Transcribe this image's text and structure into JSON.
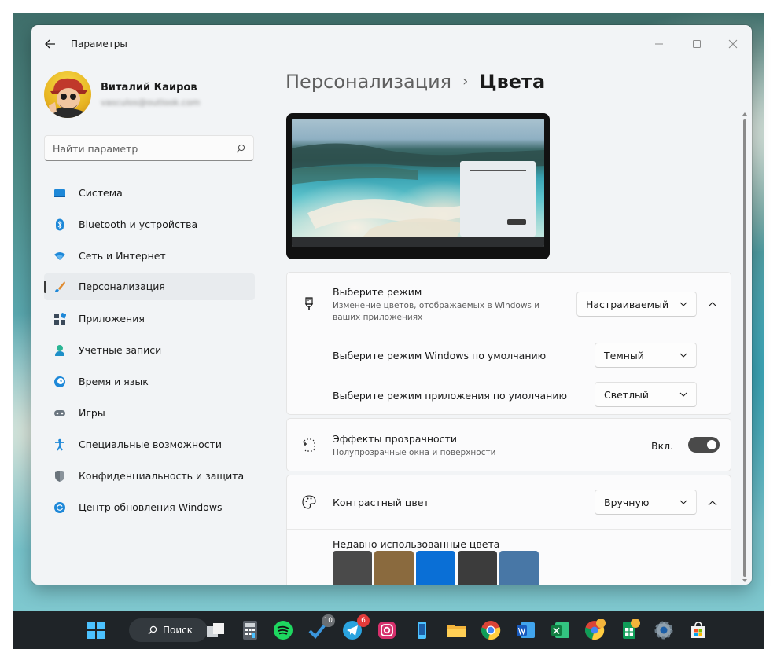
{
  "window": {
    "title": "Параметры"
  },
  "profile": {
    "name": "Виталий Каиров",
    "email": "vasculos@outlook.com"
  },
  "search": {
    "placeholder": "Найти параметр"
  },
  "sidebar": {
    "items": [
      {
        "label": "Система",
        "icon": "system-icon",
        "selected": false
      },
      {
        "label": "Bluetooth и устройства",
        "icon": "bluetooth-icon",
        "selected": false
      },
      {
        "label": "Сеть и Интернет",
        "icon": "wifi-icon",
        "selected": false
      },
      {
        "label": "Персонализация",
        "icon": "brush-icon",
        "selected": true
      },
      {
        "label": "Приложения",
        "icon": "apps-icon",
        "selected": false
      },
      {
        "label": "Учетные записи",
        "icon": "user-icon",
        "selected": false
      },
      {
        "label": "Время и язык",
        "icon": "clock-globe-icon",
        "selected": false
      },
      {
        "label": "Игры",
        "icon": "gamepad-icon",
        "selected": false
      },
      {
        "label": "Специальные возможности",
        "icon": "accessibility-icon",
        "selected": false
      },
      {
        "label": "Конфиденциальность и защита",
        "icon": "shield-icon",
        "selected": false
      },
      {
        "label": "Центр обновления Windows",
        "icon": "update-icon",
        "selected": false
      }
    ]
  },
  "breadcrumb": {
    "parent": "Персонализация",
    "separator": "›",
    "current": "Цвета"
  },
  "mode_card": {
    "title": "Выберите режим",
    "subtitle": "Изменение цветов, отображаемых в Windows и ваших приложениях",
    "value": "Настраиваемый",
    "expanded": true,
    "windows_mode": {
      "label": "Выберите режим Windows по умолчанию",
      "value": "Темный"
    },
    "app_mode": {
      "label": "Выберите режим приложения по умолчанию",
      "value": "Светлый"
    }
  },
  "transparency_card": {
    "title": "Эффекты прозрачности",
    "subtitle": "Полупрозрачные окна и поверхности",
    "state_label": "Вкл.",
    "on": true
  },
  "accent_card": {
    "title": "Контрастный цвет",
    "value": "Вручную",
    "expanded": true,
    "recent_label": "Недавно использованные цвета",
    "recent_colors": [
      "#4a4a4a",
      "#8a6a3e",
      "#0a6fd6",
      "#3c3c3c",
      "#4877a6"
    ]
  },
  "taskbar": {
    "search_label": "Поиск",
    "apps": [
      {
        "icon": "windows-start-icon"
      },
      {
        "icon": "task-view-icon"
      },
      {
        "icon": "calculator-icon"
      },
      {
        "icon": "spotify-icon"
      },
      {
        "icon": "todo-icon",
        "badge": "10"
      },
      {
        "icon": "telegram-icon",
        "badge": "6"
      },
      {
        "icon": "instagram-icon"
      },
      {
        "icon": "phone-link-icon"
      },
      {
        "icon": "file-explorer-icon"
      },
      {
        "icon": "chrome-icon"
      },
      {
        "icon": "word-icon"
      },
      {
        "icon": "excel-icon"
      },
      {
        "icon": "chrome-profile-icon"
      },
      {
        "icon": "sheets-icon"
      },
      {
        "icon": "settings-icon"
      },
      {
        "icon": "store-icon"
      }
    ]
  },
  "colors": {
    "toggle_on": "#4a4a4a",
    "selected_nav": "#e8ebee",
    "window_bg": "#f2f4f6"
  }
}
